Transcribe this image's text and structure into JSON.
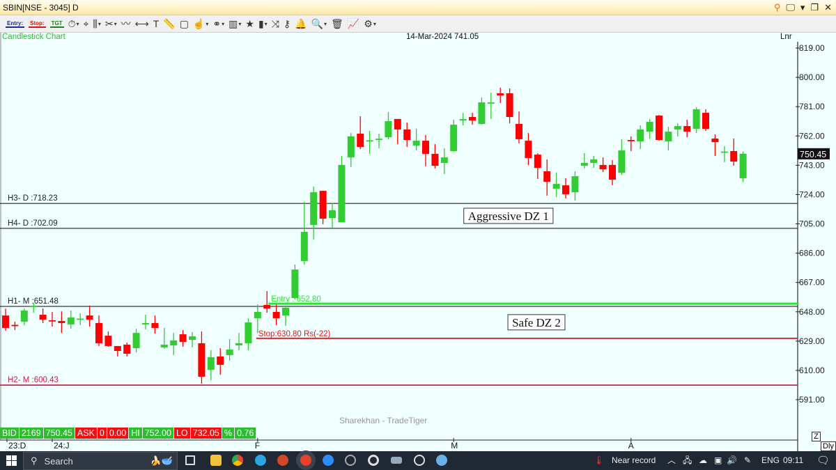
{
  "window": {
    "title": "SBIN[NSE - 3045] D",
    "controls": [
      "search-icon",
      "monitor-icon",
      "dropdown-icon",
      "restore-icon",
      "close-icon"
    ]
  },
  "toolbar": {
    "entry_label": "Entry:",
    "stop_label": "Stop:",
    "tgt_label": "TGT",
    "icons": [
      "stopwatch-icon",
      "crosshair-icon",
      "candle-icon",
      "scissors-icon",
      "trendline-icon",
      "hline-icon",
      "text-icon",
      "ruler-icon",
      "rectangle-icon",
      "hand-icon",
      "link-icon",
      "book-icon",
      "star-icon",
      "bars-icon",
      "shuffle-icon",
      "key-icon",
      "bell-icon",
      "zoom-icon",
      "delete-icon",
      "chart-line-icon",
      "gear-icon"
    ]
  },
  "chart_header": {
    "type_label": "Candlestick Chart",
    "date_price": "14-Mar-2024 741.05",
    "scale_label": "Lnr"
  },
  "watermark": "Sharekhan - TradeTiger",
  "colors": {
    "up": "#33cc33",
    "down": "#ff0000",
    "entry": "#22ee22",
    "stop": "#ee1111",
    "h2": "#cc2244",
    "background": "#f0ffff"
  },
  "chart_data": {
    "type": "candlestick",
    "ylim": [
      585,
      825
    ],
    "yticks": [
      "819.00",
      "800.00",
      "781.00",
      "762.00",
      "743.00",
      "724.00",
      "705.00",
      "686.00",
      "667.00",
      "648.00",
      "629.00",
      "610.00",
      "591.00"
    ],
    "xticks": [
      {
        "label": "23:D",
        "index": 0
      },
      {
        "label": "24:J",
        "index": 5
      },
      {
        "label": "F",
        "index": 27
      },
      {
        "label": "M",
        "index": 48
      },
      {
        "label": "A",
        "index": 67
      }
    ],
    "last_price": "750.45",
    "ohlc": [
      [
        645.6,
        637.5,
        650.1,
        635.7
      ],
      [
        639.5,
        639.0,
        641.6,
        636.1
      ],
      [
        641.6,
        648.8,
        650.1,
        639.3
      ],
      [
        651.0,
        651.9,
        653.7,
        647.4
      ],
      [
        646.1,
        642.9,
        650.1,
        640.7
      ],
      [
        642.5,
        642.0,
        647.9,
        638.4
      ],
      [
        642.0,
        640.7,
        648.3,
        634.3
      ],
      [
        639.8,
        644.3,
        648.8,
        637.0
      ],
      [
        643.3,
        643.6,
        647.0,
        639.3
      ],
      [
        645.6,
        642.9,
        652.0,
        638.4
      ],
      [
        640.7,
        627.6,
        645.6,
        625.8
      ],
      [
        632.5,
        625.8,
        635.2,
        625.3
      ],
      [
        625.8,
        622.6,
        625.8,
        619.0
      ],
      [
        626.7,
        620.8,
        628.0,
        619.0
      ],
      [
        624.4,
        634.3,
        637.0,
        621.7
      ],
      [
        639.8,
        640.7,
        646.1,
        636.6
      ],
      [
        640.7,
        637.5,
        645.6,
        633.9
      ],
      [
        624.9,
        626.7,
        637.5,
        624.0
      ],
      [
        626.2,
        629.4,
        634.3,
        619.9
      ],
      [
        633.4,
        628.5,
        636.1,
        625.3
      ],
      [
        629.8,
        632.1,
        634.8,
        624.9
      ],
      [
        627.6,
        605.9,
        635.2,
        601.4
      ],
      [
        610.4,
        618.5,
        623.1,
        603.6
      ],
      [
        619.0,
        613.6,
        624.4,
        607.2
      ],
      [
        619.9,
        623.5,
        630.3,
        616.3
      ],
      [
        626.2,
        627.6,
        634.3,
        623.1
      ],
      [
        627.6,
        641.1,
        643.8,
        623.1
      ],
      [
        643.8,
        647.9,
        652.8,
        634.3
      ],
      [
        652.4,
        650.1,
        661.4,
        647.4
      ],
      [
        647.9,
        643.8,
        652.8,
        639.3
      ],
      [
        645.6,
        650.6,
        651.5,
        638.8
      ],
      [
        656.9,
        675.4,
        678.6,
        656.0
      ],
      [
        680.9,
        699.8,
        719.2,
        678.6
      ],
      [
        704.3,
        725.5,
        729.1,
        694.8
      ],
      [
        726.4,
        708.4,
        726.4,
        704.8
      ],
      [
        708.8,
        713.8,
        718.3,
        702.5
      ],
      [
        706.1,
        743.2,
        749.0,
        706.1
      ],
      [
        748.1,
        761.7,
        763.9,
        741.8
      ],
      [
        763.5,
        754.9,
        774.8,
        753.5
      ],
      [
        759.0,
        759.2,
        765.3,
        750.4
      ],
      [
        759.6,
        760.2,
        763.5,
        754.0
      ],
      [
        761.2,
        771.6,
        777.5,
        759.8
      ],
      [
        773.0,
        766.2,
        773.0,
        756.7
      ],
      [
        766.2,
        759.4,
        770.7,
        754.9
      ],
      [
        755.8,
        758.9,
        766.6,
        752.6
      ],
      [
        758.9,
        750.4,
        762.6,
        742.3
      ],
      [
        750.4,
        742.7,
        756.7,
        740.9
      ],
      [
        744.5,
        748.1,
        754.0,
        737.3
      ],
      [
        752.2,
        769.3,
        772.5,
        751.7
      ],
      [
        772.0,
        772.9,
        777.0,
        768.9
      ],
      [
        774.3,
        772.0,
        777.0,
        769.3
      ],
      [
        769.8,
        783.8,
        786.9,
        769.3
      ],
      [
        783.5,
        783.8,
        790.1,
        773.0
      ],
      [
        789.7,
        788.3,
        793.3,
        783.3
      ],
      [
        789.7,
        774.3,
        792.8,
        770.2
      ],
      [
        769.8,
        759.9,
        777.9,
        757.1
      ],
      [
        758.9,
        747.7,
        763.9,
        743.2
      ],
      [
        749.9,
        741.3,
        750.8,
        734.1
      ],
      [
        739.1,
        732.3,
        746.8,
        723.3
      ],
      [
        727.8,
        730.9,
        738.2,
        722.4
      ],
      [
        730.0,
        724.2,
        734.6,
        721.5
      ],
      [
        725.5,
        735.9,
        739.1,
        720.1
      ],
      [
        742.7,
        744.5,
        750.8,
        740.9
      ],
      [
        744.5,
        746.8,
        749.0,
        741.3
      ],
      [
        743.2,
        740.4,
        748.1,
        738.6
      ],
      [
        743.2,
        733.7,
        746.3,
        730.0
      ],
      [
        738.2,
        752.6,
        759.9,
        736.8
      ],
      [
        759.4,
        759.0,
        761.7,
        752.2
      ],
      [
        758.5,
        766.2,
        768.9,
        753.5
      ],
      [
        764.8,
        771.2,
        773.0,
        760.3
      ],
      [
        775.2,
        759.4,
        775.7,
        758.9
      ],
      [
        758.5,
        764.8,
        768.0,
        752.6
      ],
      [
        766.2,
        768.4,
        770.2,
        761.7
      ],
      [
        768.4,
        764.8,
        772.5,
        761.2
      ],
      [
        766.6,
        779.3,
        780.6,
        763.9
      ],
      [
        777.0,
        766.6,
        779.3,
        765.3
      ],
      [
        760.3,
        758.0,
        763.0,
        749.0
      ],
      [
        751.7,
        751.9,
        755.4,
        745.0
      ],
      [
        752.2,
        745.4,
        760.3,
        742.7
      ],
      [
        734.6,
        750.45,
        752.0,
        732.05
      ]
    ],
    "levels": [
      {
        "label": "H3- D :718.23",
        "value": 718.23,
        "color": "#222222"
      },
      {
        "label": "H4- D :702.09",
        "value": 702.09,
        "color": "#222222"
      },
      {
        "label": "H1- M :651.48",
        "value": 651.48,
        "color": "#222222"
      },
      {
        "label": "H2- M :600.43",
        "value": 600.43,
        "color": "#cc2244"
      }
    ],
    "entry": {
      "label": "Entry : 652.80",
      "value": 652.8,
      "from_index": 28
    },
    "stop": {
      "label": "Stop:630.80 Rs(-22)",
      "value": 630.8,
      "from_index": 27
    },
    "annotations": [
      {
        "text": "Aggressive DZ 1",
        "price": 710.2,
        "index": 52
      },
      {
        "text": "Safe DZ 2",
        "price": 641.2,
        "index": 55
      }
    ]
  },
  "status_bar": [
    {
      "text": "BID",
      "c": "g"
    },
    {
      "text": "2169",
      "c": "g"
    },
    {
      "text": "750.45",
      "c": "g"
    },
    {
      "text": "ASK",
      "c": "r"
    },
    {
      "text": "0",
      "c": "r"
    },
    {
      "text": "0.00",
      "c": "r"
    },
    {
      "text": "HI",
      "c": "g"
    },
    {
      "text": "752.00",
      "c": "g"
    },
    {
      "text": "LO",
      "c": "r"
    },
    {
      "text": "732.05",
      "c": "r"
    },
    {
      "text": "%",
      "c": "g"
    },
    {
      "text": "0.76",
      "c": "g"
    }
  ],
  "corner": {
    "zoom_label": "Z",
    "period_label": "Dly"
  },
  "taskbar": {
    "search_placeholder": "Search",
    "weather": "Near record",
    "lang": "ENG",
    "time": "09:11"
  }
}
